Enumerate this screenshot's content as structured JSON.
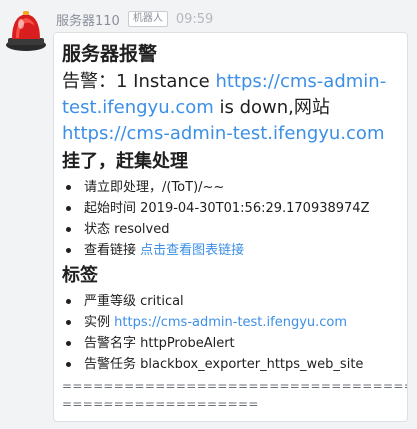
{
  "sender": {
    "name": "服务器110",
    "badge": "机器人",
    "time": "09:59",
    "avatar_icon": "red-alarm-siren-icon"
  },
  "message": {
    "title": "服务器报警",
    "alert_prefix": "告警：1 Instance ",
    "alert_url": "https://cms-admin-test.ifengyu.com",
    "alert_mid": " is down,网站",
    "site_url": "https://cms-admin-test.ifengyu.com",
    "subtitle": "挂了，赶集处理",
    "bullets": [
      {
        "label": "请立即处理，/(ToT)/~~",
        "link": ""
      },
      {
        "label": "起始时间 2019-04-30T01:56:29.170938974Z",
        "link": ""
      },
      {
        "label": "状态 resolved",
        "link": ""
      },
      {
        "label": "查看链接 ",
        "link": "点击查看图表链接"
      }
    ],
    "tags_heading": "标签",
    "tags": [
      {
        "label": "严重等级 critical",
        "link": ""
      },
      {
        "label": "实例 ",
        "link": "https://cms-admin-test.ifengyu.com"
      },
      {
        "label": "告警名字 httpProbeAlert",
        "link": ""
      },
      {
        "label": "告警任务 blackbox_exporter_https_web_site",
        "link": ""
      }
    ],
    "divider_line1": "========================================",
    "divider_line2": "==================="
  },
  "colors": {
    "link": "#3c8fe6",
    "bubble_bg": "#ffffff",
    "page_bg": "#f2f3f5",
    "meta_text": "#8a8f99",
    "siren_red": "#e02020"
  }
}
